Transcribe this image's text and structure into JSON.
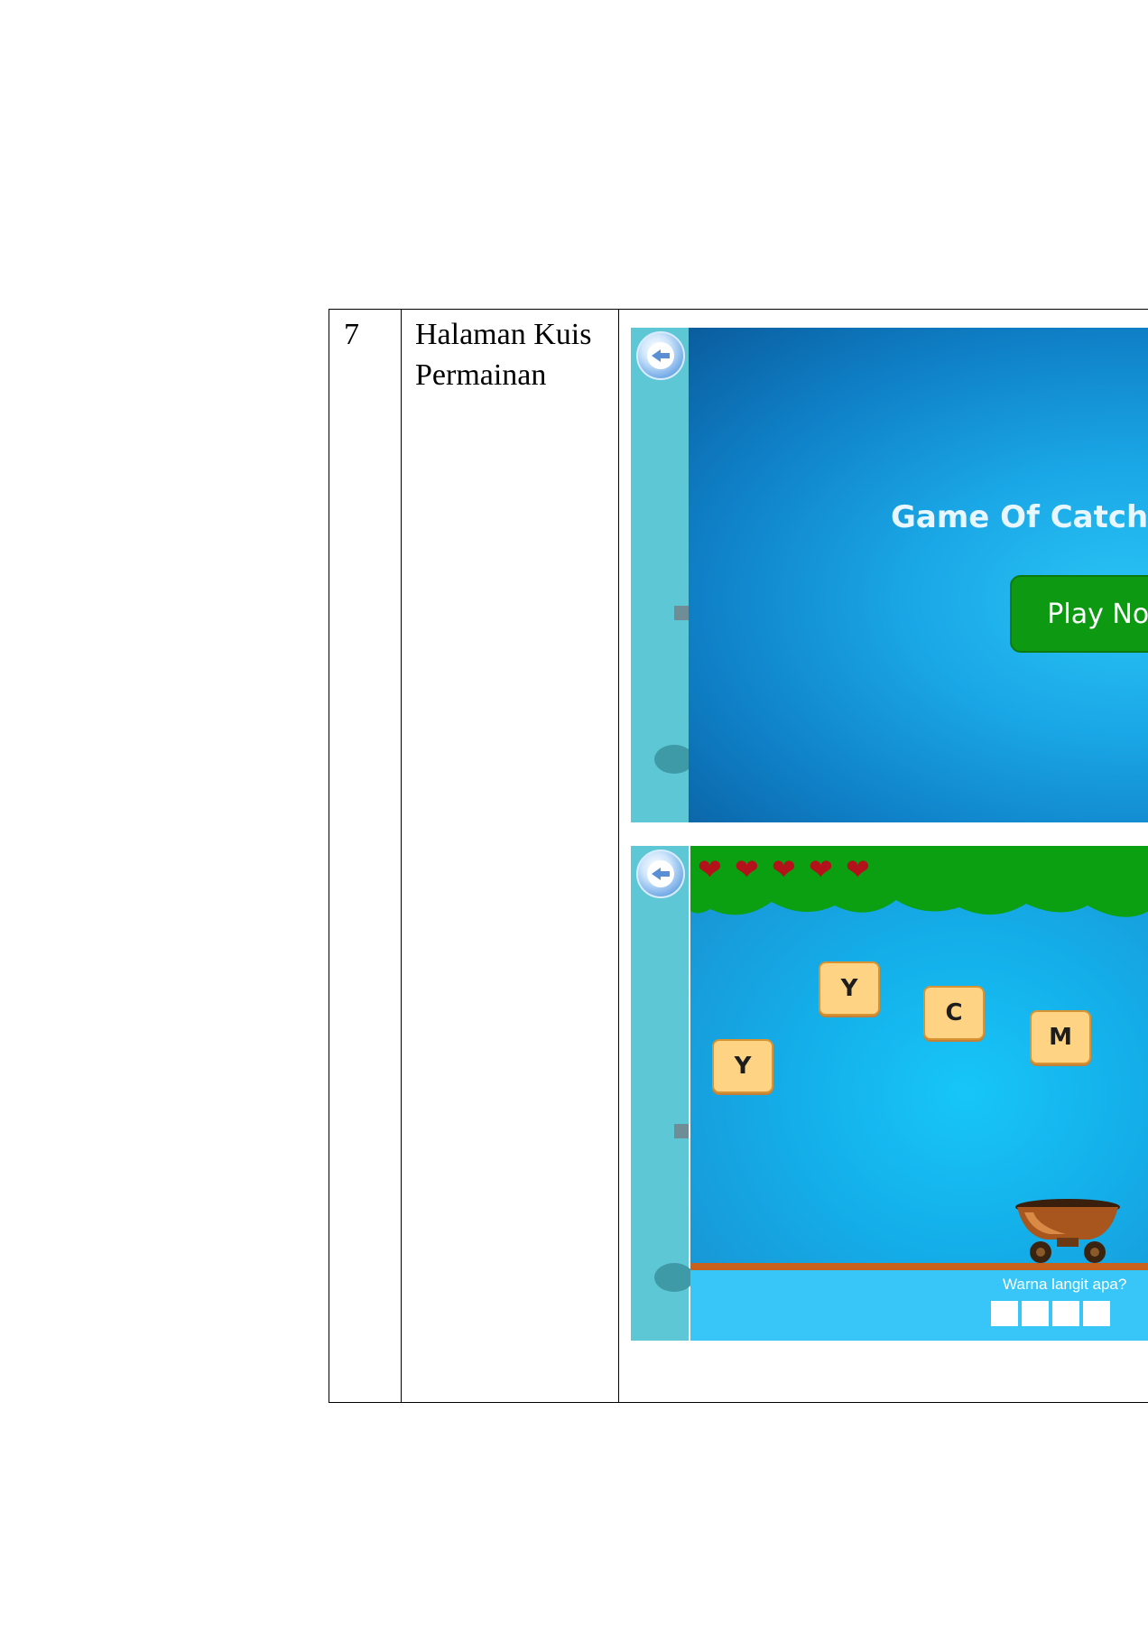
{
  "row": {
    "number": "7",
    "label": "Halaman Kuis Permainan"
  },
  "screen1": {
    "title": "Game Of Catching Th",
    "play_button": "Play Now"
  },
  "screen2": {
    "lives": 5,
    "letters": [
      "Y",
      "C",
      "M",
      "Y"
    ],
    "question": "Warna langit apa?",
    "answer_boxes": 4
  },
  "colors": {
    "sky": "#1aa7e6",
    "play_button": "#0d9a12",
    "tile": "#ffd384",
    "heart": "#b3121a",
    "leaves": "#0aa012"
  }
}
